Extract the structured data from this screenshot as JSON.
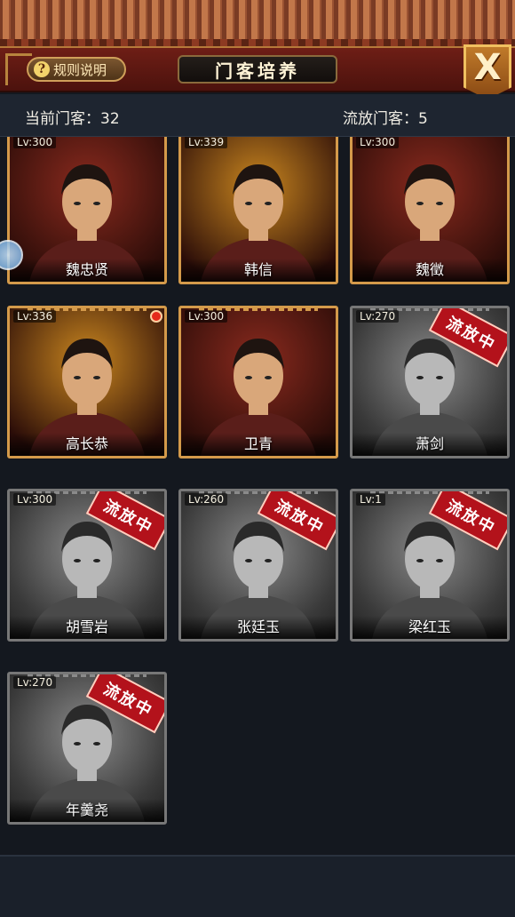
{
  "header": {
    "rules_label": "规则说明",
    "rules_icon": "?",
    "title": "门客培养",
    "close_label": "X"
  },
  "stats": {
    "current_label": "当前门客：32",
    "exiled_label": "流放门客：5"
  },
  "exile_stamp": "流放中",
  "cards": [
    {
      "name": "魏忠贤",
      "level": "Lv:300",
      "exiled": false,
      "color": "#8a2a1e"
    },
    {
      "name": "韩信",
      "level": "Lv:339",
      "exiled": false,
      "color": "#c9861f"
    },
    {
      "name": "魏徵",
      "level": "Lv:300",
      "exiled": false,
      "color": "#8a2a1e"
    },
    {
      "name": "高长恭",
      "level": "Lv:336",
      "exiled": false,
      "color": "#c9861f",
      "notice": true
    },
    {
      "name": "卫青",
      "level": "Lv:300",
      "exiled": false,
      "color": "#8a2a1e"
    },
    {
      "name": "萧剑",
      "level": "Lv:270",
      "exiled": true,
      "color": "#555"
    },
    {
      "name": "胡雪岩",
      "level": "Lv:300",
      "exiled": true,
      "color": "#555"
    },
    {
      "name": "张廷玉",
      "level": "Lv:260",
      "exiled": true,
      "color": "#555"
    },
    {
      "name": "梁红玉",
      "level": "Lv:1",
      "exiled": true,
      "color": "#555"
    },
    {
      "name": "年羹尧",
      "level": "Lv:270",
      "exiled": true,
      "color": "#555"
    }
  ]
}
